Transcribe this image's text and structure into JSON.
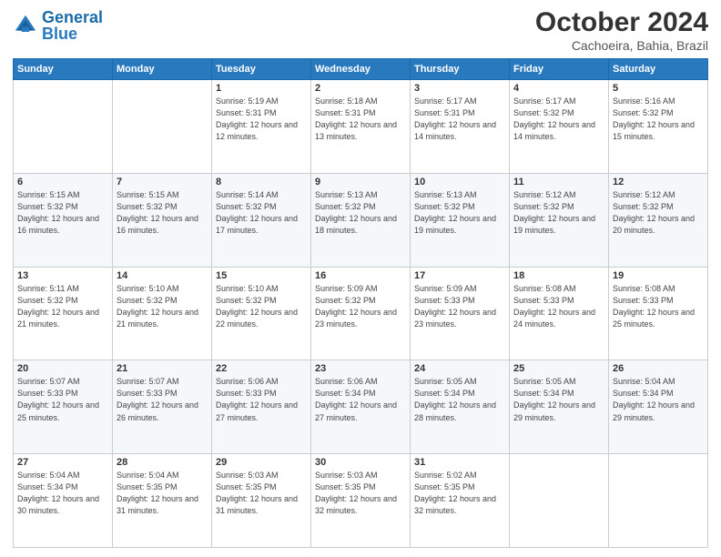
{
  "header": {
    "logo_general": "General",
    "logo_blue": "Blue",
    "month_title": "October 2024",
    "location": "Cachoeira, Bahia, Brazil"
  },
  "days_of_week": [
    "Sunday",
    "Monday",
    "Tuesday",
    "Wednesday",
    "Thursday",
    "Friday",
    "Saturday"
  ],
  "weeks": [
    [
      {
        "num": "",
        "sunrise": "",
        "sunset": "",
        "daylight": ""
      },
      {
        "num": "",
        "sunrise": "",
        "sunset": "",
        "daylight": ""
      },
      {
        "num": "1",
        "sunrise": "Sunrise: 5:19 AM",
        "sunset": "Sunset: 5:31 PM",
        "daylight": "Daylight: 12 hours and 12 minutes."
      },
      {
        "num": "2",
        "sunrise": "Sunrise: 5:18 AM",
        "sunset": "Sunset: 5:31 PM",
        "daylight": "Daylight: 12 hours and 13 minutes."
      },
      {
        "num": "3",
        "sunrise": "Sunrise: 5:17 AM",
        "sunset": "Sunset: 5:31 PM",
        "daylight": "Daylight: 12 hours and 14 minutes."
      },
      {
        "num": "4",
        "sunrise": "Sunrise: 5:17 AM",
        "sunset": "Sunset: 5:32 PM",
        "daylight": "Daylight: 12 hours and 14 minutes."
      },
      {
        "num": "5",
        "sunrise": "Sunrise: 5:16 AM",
        "sunset": "Sunset: 5:32 PM",
        "daylight": "Daylight: 12 hours and 15 minutes."
      }
    ],
    [
      {
        "num": "6",
        "sunrise": "Sunrise: 5:15 AM",
        "sunset": "Sunset: 5:32 PM",
        "daylight": "Daylight: 12 hours and 16 minutes."
      },
      {
        "num": "7",
        "sunrise": "Sunrise: 5:15 AM",
        "sunset": "Sunset: 5:32 PM",
        "daylight": "Daylight: 12 hours and 16 minutes."
      },
      {
        "num": "8",
        "sunrise": "Sunrise: 5:14 AM",
        "sunset": "Sunset: 5:32 PM",
        "daylight": "Daylight: 12 hours and 17 minutes."
      },
      {
        "num": "9",
        "sunrise": "Sunrise: 5:13 AM",
        "sunset": "Sunset: 5:32 PM",
        "daylight": "Daylight: 12 hours and 18 minutes."
      },
      {
        "num": "10",
        "sunrise": "Sunrise: 5:13 AM",
        "sunset": "Sunset: 5:32 PM",
        "daylight": "Daylight: 12 hours and 19 minutes."
      },
      {
        "num": "11",
        "sunrise": "Sunrise: 5:12 AM",
        "sunset": "Sunset: 5:32 PM",
        "daylight": "Daylight: 12 hours and 19 minutes."
      },
      {
        "num": "12",
        "sunrise": "Sunrise: 5:12 AM",
        "sunset": "Sunset: 5:32 PM",
        "daylight": "Daylight: 12 hours and 20 minutes."
      }
    ],
    [
      {
        "num": "13",
        "sunrise": "Sunrise: 5:11 AM",
        "sunset": "Sunset: 5:32 PM",
        "daylight": "Daylight: 12 hours and 21 minutes."
      },
      {
        "num": "14",
        "sunrise": "Sunrise: 5:10 AM",
        "sunset": "Sunset: 5:32 PM",
        "daylight": "Daylight: 12 hours and 21 minutes."
      },
      {
        "num": "15",
        "sunrise": "Sunrise: 5:10 AM",
        "sunset": "Sunset: 5:32 PM",
        "daylight": "Daylight: 12 hours and 22 minutes."
      },
      {
        "num": "16",
        "sunrise": "Sunrise: 5:09 AM",
        "sunset": "Sunset: 5:32 PM",
        "daylight": "Daylight: 12 hours and 23 minutes."
      },
      {
        "num": "17",
        "sunrise": "Sunrise: 5:09 AM",
        "sunset": "Sunset: 5:33 PM",
        "daylight": "Daylight: 12 hours and 23 minutes."
      },
      {
        "num": "18",
        "sunrise": "Sunrise: 5:08 AM",
        "sunset": "Sunset: 5:33 PM",
        "daylight": "Daylight: 12 hours and 24 minutes."
      },
      {
        "num": "19",
        "sunrise": "Sunrise: 5:08 AM",
        "sunset": "Sunset: 5:33 PM",
        "daylight": "Daylight: 12 hours and 25 minutes."
      }
    ],
    [
      {
        "num": "20",
        "sunrise": "Sunrise: 5:07 AM",
        "sunset": "Sunset: 5:33 PM",
        "daylight": "Daylight: 12 hours and 25 minutes."
      },
      {
        "num": "21",
        "sunrise": "Sunrise: 5:07 AM",
        "sunset": "Sunset: 5:33 PM",
        "daylight": "Daylight: 12 hours and 26 minutes."
      },
      {
        "num": "22",
        "sunrise": "Sunrise: 5:06 AM",
        "sunset": "Sunset: 5:33 PM",
        "daylight": "Daylight: 12 hours and 27 minutes."
      },
      {
        "num": "23",
        "sunrise": "Sunrise: 5:06 AM",
        "sunset": "Sunset: 5:34 PM",
        "daylight": "Daylight: 12 hours and 27 minutes."
      },
      {
        "num": "24",
        "sunrise": "Sunrise: 5:05 AM",
        "sunset": "Sunset: 5:34 PM",
        "daylight": "Daylight: 12 hours and 28 minutes."
      },
      {
        "num": "25",
        "sunrise": "Sunrise: 5:05 AM",
        "sunset": "Sunset: 5:34 PM",
        "daylight": "Daylight: 12 hours and 29 minutes."
      },
      {
        "num": "26",
        "sunrise": "Sunrise: 5:04 AM",
        "sunset": "Sunset: 5:34 PM",
        "daylight": "Daylight: 12 hours and 29 minutes."
      }
    ],
    [
      {
        "num": "27",
        "sunrise": "Sunrise: 5:04 AM",
        "sunset": "Sunset: 5:34 PM",
        "daylight": "Daylight: 12 hours and 30 minutes."
      },
      {
        "num": "28",
        "sunrise": "Sunrise: 5:04 AM",
        "sunset": "Sunset: 5:35 PM",
        "daylight": "Daylight: 12 hours and 31 minutes."
      },
      {
        "num": "29",
        "sunrise": "Sunrise: 5:03 AM",
        "sunset": "Sunset: 5:35 PM",
        "daylight": "Daylight: 12 hours and 31 minutes."
      },
      {
        "num": "30",
        "sunrise": "Sunrise: 5:03 AM",
        "sunset": "Sunset: 5:35 PM",
        "daylight": "Daylight: 12 hours and 32 minutes."
      },
      {
        "num": "31",
        "sunrise": "Sunrise: 5:02 AM",
        "sunset": "Sunset: 5:35 PM",
        "daylight": "Daylight: 12 hours and 32 minutes."
      },
      {
        "num": "",
        "sunrise": "",
        "sunset": "",
        "daylight": ""
      },
      {
        "num": "",
        "sunrise": "",
        "sunset": "",
        "daylight": ""
      }
    ]
  ]
}
